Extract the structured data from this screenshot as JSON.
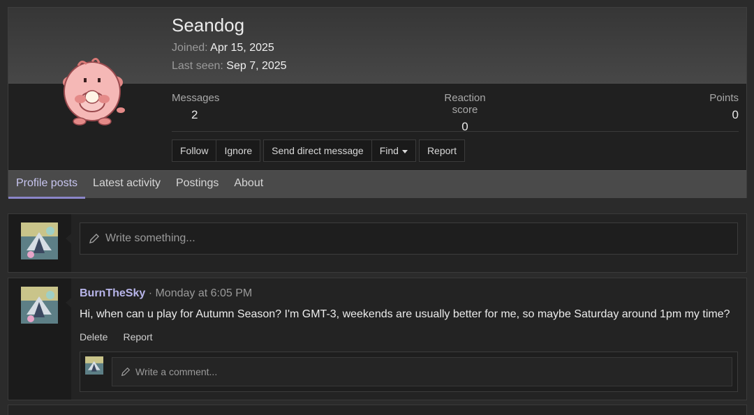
{
  "profile": {
    "username": "Seandog",
    "joined_label": "Joined:",
    "joined_value": "Apr 15, 2025",
    "last_seen_label": "Last seen:",
    "last_seen_value": "Sep 7, 2025",
    "stats": {
      "messages_label": "Messages",
      "messages_value": "2",
      "reaction_label": "Reaction score",
      "reaction_value": "0",
      "points_label": "Points",
      "points_value": "0"
    },
    "buttons": {
      "follow": "Follow",
      "ignore": "Ignore",
      "send_dm": "Send direct message",
      "find": "Find",
      "report": "Report"
    }
  },
  "tabs": [
    {
      "label": "Profile posts",
      "active": true
    },
    {
      "label": "Latest activity"
    },
    {
      "label": "Postings"
    },
    {
      "label": "About"
    }
  ],
  "write_box": {
    "placeholder": "Write something..."
  },
  "post": {
    "author": "BurnTheSky",
    "time": "· Monday at 6:05 PM",
    "body": "Hi, when can u play for Autumn Season? I'm GMT-3, weekends are usually better for me, so maybe Saturday around 1pm my time?",
    "delete": "Delete",
    "report": "Report",
    "comment_placeholder": "Write a comment..."
  },
  "colors": {
    "accent": "#8b86c9",
    "username_link": "#b8b5ea",
    "background": "#2b2b2b"
  }
}
